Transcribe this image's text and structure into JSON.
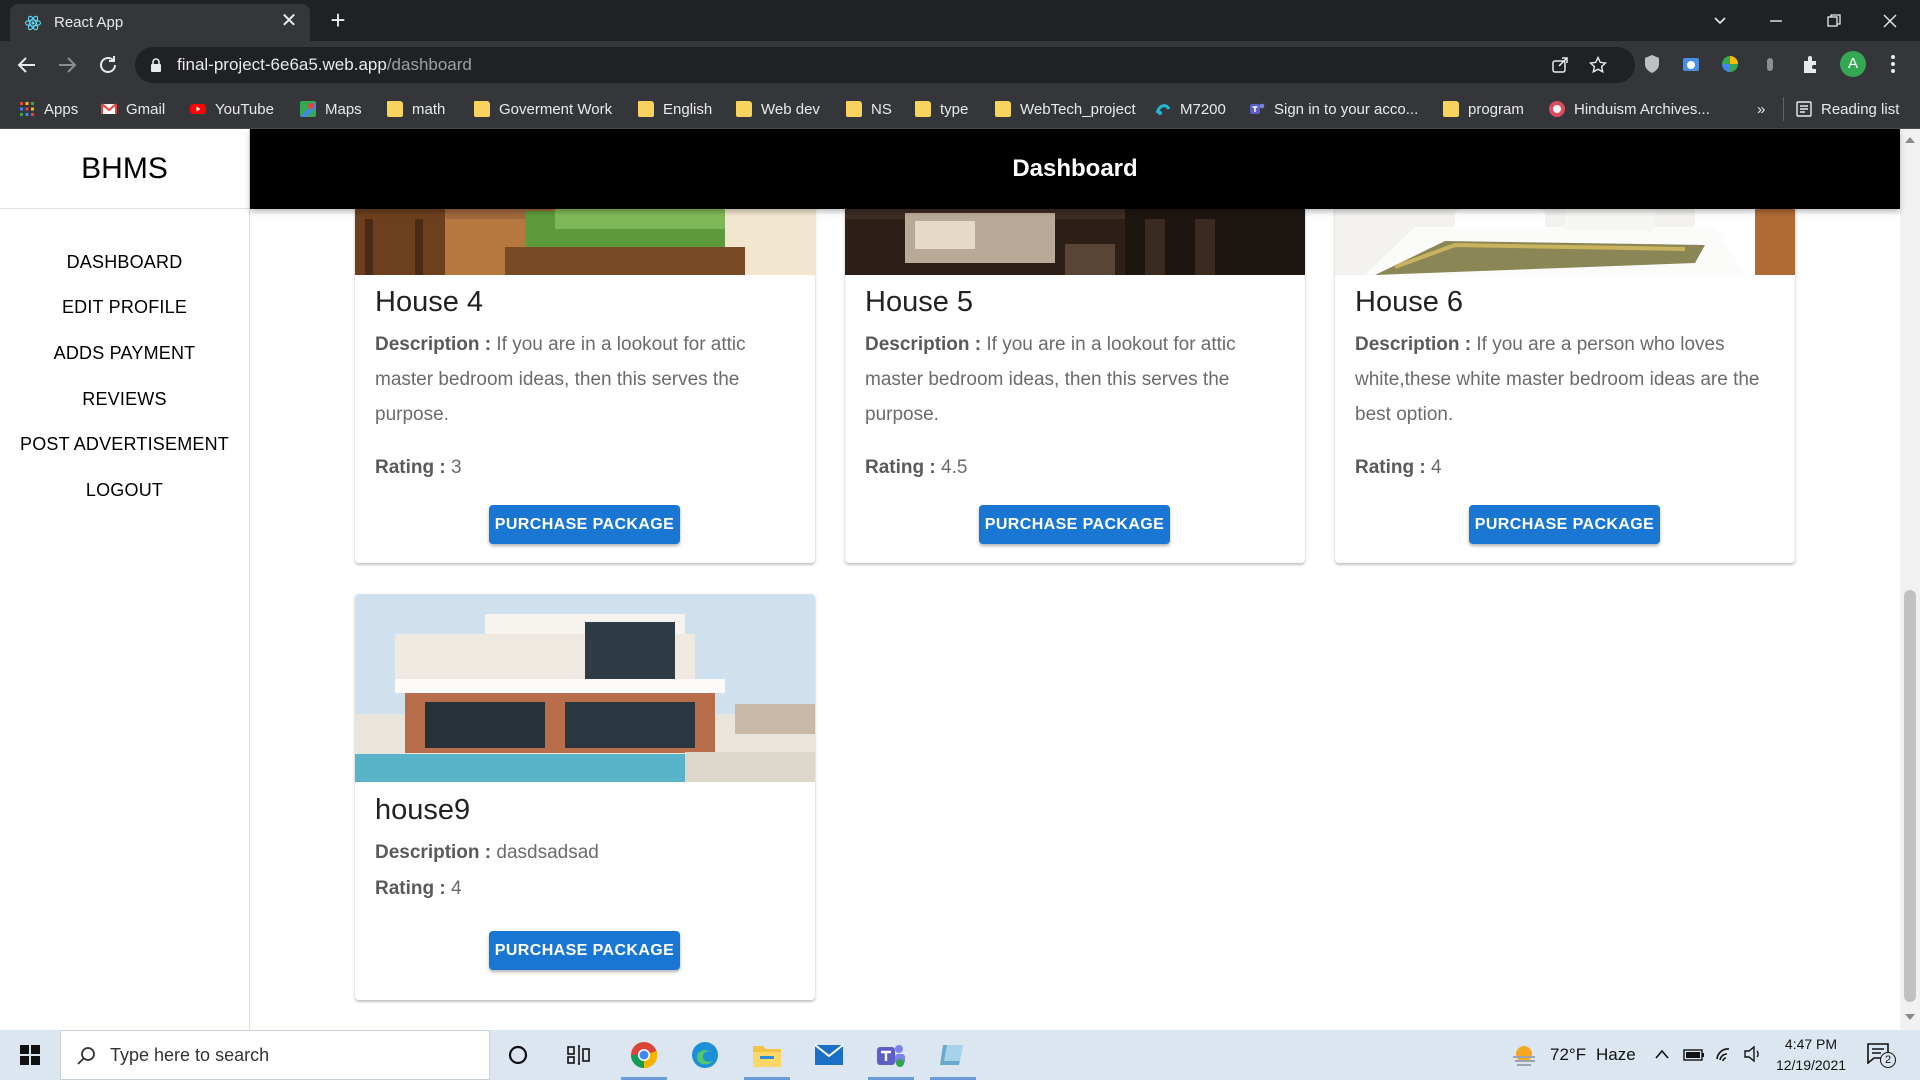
{
  "browser": {
    "tab_title": "React App",
    "url_host": "final-project-6e6a5.web.app",
    "url_path": "/dashboard",
    "bookmarks": [
      {
        "label": "Apps",
        "icon": "apps-grid-icon"
      },
      {
        "label": "Gmail",
        "icon": "gmail-icon"
      },
      {
        "label": "YouTube",
        "icon": "youtube-icon"
      },
      {
        "label": "Maps",
        "icon": "maps-icon"
      },
      {
        "label": "math",
        "icon": "folder-icon"
      },
      {
        "label": "Goverment Work",
        "icon": "folder-icon"
      },
      {
        "label": "English",
        "icon": "folder-icon"
      },
      {
        "label": "Web dev",
        "icon": "folder-icon"
      },
      {
        "label": "NS",
        "icon": "folder-icon"
      },
      {
        "label": "type",
        "icon": "folder-icon"
      },
      {
        "label": "WebTech_project",
        "icon": "folder-icon"
      },
      {
        "label": "M7200",
        "icon": "m7200-icon"
      },
      {
        "label": "Sign in to your acco...",
        "icon": "teams-icon"
      },
      {
        "label": "program",
        "icon": "folder-icon"
      },
      {
        "label": "Hinduism Archives...",
        "icon": "hinduism-icon"
      }
    ],
    "more_bookmarks": "»",
    "reading_list": "Reading list",
    "profile_initial": "A"
  },
  "app": {
    "brand": "BHMS",
    "header_title": "Dashboard",
    "nav": [
      "DASHBOARD",
      "EDIT PROFILE",
      "ADDS PAYMENT",
      "REVIEWS",
      "POST ADVERTISEMENT",
      "LOGOUT"
    ],
    "labels": {
      "description": "Description :",
      "rating": "Rating :",
      "purchase": "PURCHASE PACKAGE"
    },
    "cards": [
      {
        "title": "House 4",
        "description": "If you are in a lookout for attic master bedroom ideas, then this serves the purpose.",
        "rating": "3"
      },
      {
        "title": "House 5",
        "description": "If you are in a lookout for attic master bedroom ideas, then this serves the purpose.",
        "rating": "4.5"
      },
      {
        "title": "House 6",
        "description": "If you are a person who loves white,these white master bedroom ideas are the best option.",
        "rating": "4"
      },
      {
        "title": "house9",
        "description": "dasdsadsad",
        "rating": "4"
      }
    ]
  },
  "taskbar": {
    "search_placeholder": "Type here to search",
    "weather_temp": "72°F",
    "weather_desc": "Haze",
    "time": "4:47 PM",
    "date": "12/19/2021",
    "notification_count": "2"
  },
  "colors": {
    "primary_button": "#1976d2",
    "appbar": "#000000",
    "chrome_dark": "#202124"
  }
}
